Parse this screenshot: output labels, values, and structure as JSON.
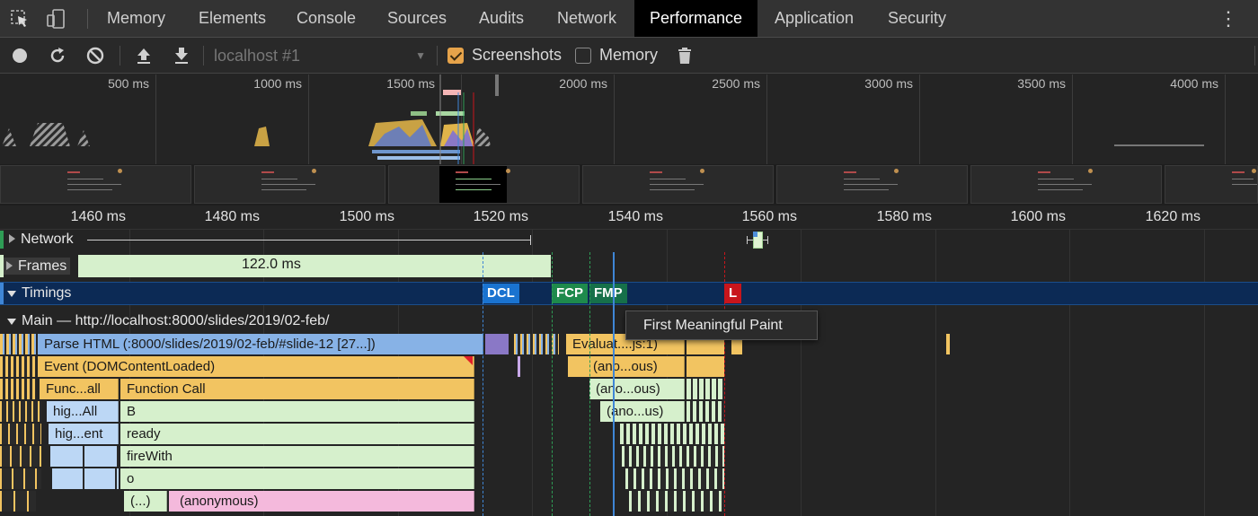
{
  "tabs": [
    "Memory",
    "Elements",
    "Console",
    "Sources",
    "Audits",
    "Network",
    "Performance",
    "Application",
    "Security"
  ],
  "active_tab": "Performance",
  "icons": {
    "inspect": "inspect-element-icon",
    "device": "device-toolbar-icon",
    "record": "record-icon",
    "reload": "reload-icon",
    "clear": "clear-icon",
    "load": "upload-icon",
    "save": "download-icon",
    "trash": "trash-icon",
    "more": "kebab-menu-icon"
  },
  "toolbar": {
    "target": "localhost #1",
    "screenshots_label": "Screenshots",
    "screenshots_checked": true,
    "memory_label": "Memory",
    "memory_checked": false
  },
  "overview": {
    "ticks": [
      "500 ms",
      "1000 ms",
      "1500 ms",
      "2000 ms",
      "2500 ms",
      "3000 ms",
      "3500 ms",
      "4000 ms"
    ]
  },
  "ruler": {
    "ticks": [
      "1460 ms",
      "1480 ms",
      "1500 ms",
      "1520 ms",
      "1540 ms",
      "1560 ms",
      "1580 ms",
      "1600 ms",
      "1620 ms"
    ]
  },
  "tracks": {
    "network": "Network",
    "frames": "Frames",
    "frames_value": "122.0 ms",
    "timings": "Timings",
    "main": "Main — http://localhost:8000/slides/2019/02-feb/"
  },
  "markers": {
    "dcl": "DCL",
    "fcp": "FCP",
    "fmp": "FMP",
    "l": "L"
  },
  "tooltip": "First Meaningful Paint",
  "flame": {
    "parse_html": "Parse HTML (:8000/slides/2019/02-feb/#slide-12 [27...])",
    "event": "Event (DOMContentLoaded)",
    "func_all": "Func...all",
    "function_call": "Function Call",
    "hig_all": "hig...All",
    "b": "B",
    "hig_ent": "hig...ent",
    "ready": "ready",
    "firewith": "fireWith",
    "o": "o",
    "paren": "(...)",
    "anonymous": "(anonymous)",
    "evaluate": "Evaluat....js:1)",
    "ano1": "(ano...ous)",
    "ano2": "(ano...ous)",
    "ano3": "(ano...us)"
  },
  "colors": {
    "accent_blue": "#3f86d6",
    "scripting": "#f2c461",
    "loading": "#87b2e6",
    "frames_green": "#d6f0cc",
    "dcl_marker": "#1a73d0",
    "fcp_marker": "#1e8a4c",
    "l_marker": "#c8151c"
  }
}
